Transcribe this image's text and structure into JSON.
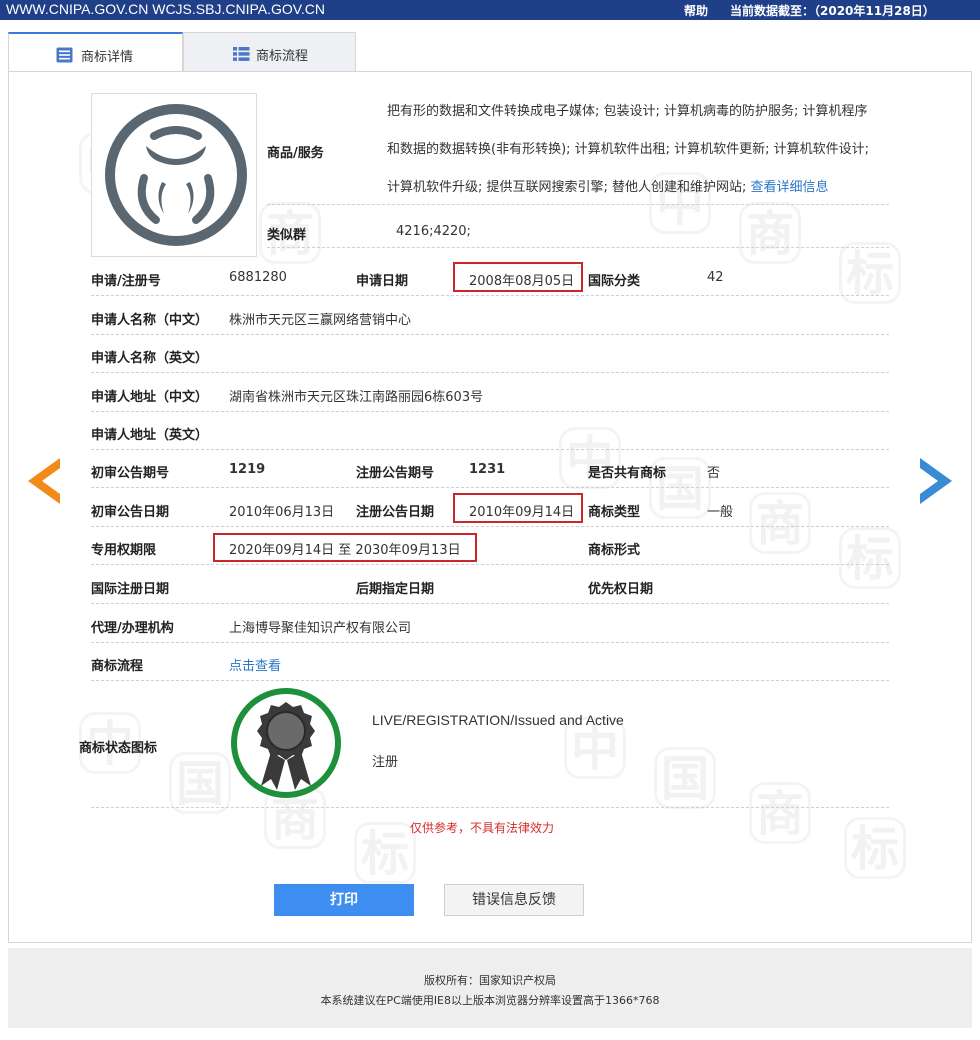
{
  "topbar": {
    "site": "WWW.CNIPA.GOV.CN WCJS.SBJ.CNIPA.GOV.CN",
    "help": "帮助",
    "data_as_of": "当前数据截至：（2020年11月28日）"
  },
  "tabs": [
    {
      "label": "商标详情",
      "active": true
    },
    {
      "label": "商标流程",
      "active": false
    }
  ],
  "watermark_chars": [
    "中",
    "国",
    "商",
    "标"
  ],
  "goods_services": {
    "label": "商品/服务",
    "lines": [
      "把有形的数据和文件转换成电子媒体; 包装设计; 计算机病毒的防护服务; 计算机程序",
      "和数据的数据转换(非有形转换); 计算机软件出租; 计算机软件更新; 计算机软件设计;",
      "计算机软件升级; 提供互联网搜索引擎; 替他人创建和维护网站; "
    ],
    "more_link": "查看详细信息"
  },
  "similar_group": {
    "label": "类似群",
    "value": "4216;4220;"
  },
  "reg_no": {
    "label": "申请/注册号",
    "value": "6881280"
  },
  "app_date": {
    "label": "申请日期",
    "value": "2008年08月05日"
  },
  "intl_class": {
    "label": "国际分类",
    "value": "42"
  },
  "applicant_cn": {
    "label": "申请人名称（中文）",
    "value": "株洲市天元区三赢网络营销中心"
  },
  "applicant_en": {
    "label": "申请人名称（英文）",
    "value": ""
  },
  "address_cn": {
    "label": "申请人地址（中文）",
    "value": "湖南省株洲市天元区珠江南路丽园6栋603号"
  },
  "address_en": {
    "label": "申请人地址（英文）",
    "value": ""
  },
  "prelim_pub_no": {
    "label": "初审公告期号",
    "value": "1219"
  },
  "reg_pub_no": {
    "label": "注册公告期号",
    "value": "1231"
  },
  "shared": {
    "label": "是否共有商标",
    "value": "否"
  },
  "prelim_pub_date": {
    "label": "初审公告日期",
    "value": "2010年06月13日"
  },
  "reg_pub_date": {
    "label": "注册公告日期",
    "value": "2010年09月14日"
  },
  "tm_type": {
    "label": "商标类型",
    "value": "一般"
  },
  "exclusive_period": {
    "label": "专用权期限",
    "value": "2020年09月14日 至 2030年09月13日"
  },
  "tm_form": {
    "label": "商标形式",
    "value": ""
  },
  "intl_reg_date": {
    "label": "国际注册日期",
    "value": ""
  },
  "later_designation": {
    "label": "后期指定日期",
    "value": ""
  },
  "priority_date": {
    "label": "优先权日期",
    "value": ""
  },
  "agent": {
    "label": "代理/办理机构",
    "value": "上海博导聚佳知识产权有限公司"
  },
  "process": {
    "label": "商标流程",
    "link": "点击查看"
  },
  "status": {
    "label": "商标状态图标",
    "en": "LIVE/REGISTRATION/Issued and Active",
    "cn": "注册"
  },
  "disclaimer": "仅供参考，不具有法律效力",
  "buttons": {
    "print": "打印",
    "feedback": "错误信息反馈"
  },
  "footer": {
    "copyright": "版权所有：国家知识产权局",
    "browser_note": "本系统建议在PC端使用IE8以上版本浏览器分辨率设置高于1366*768"
  },
  "colors": {
    "topbar": "#1f3f88",
    "link": "#2a77c9",
    "highlight_border": "#c8272b",
    "status_ring": "#1e8f3a",
    "prev_arrow": "#f28a1a",
    "next_arrow": "#3a8ad6",
    "print_button": "#3d8ef0"
  }
}
